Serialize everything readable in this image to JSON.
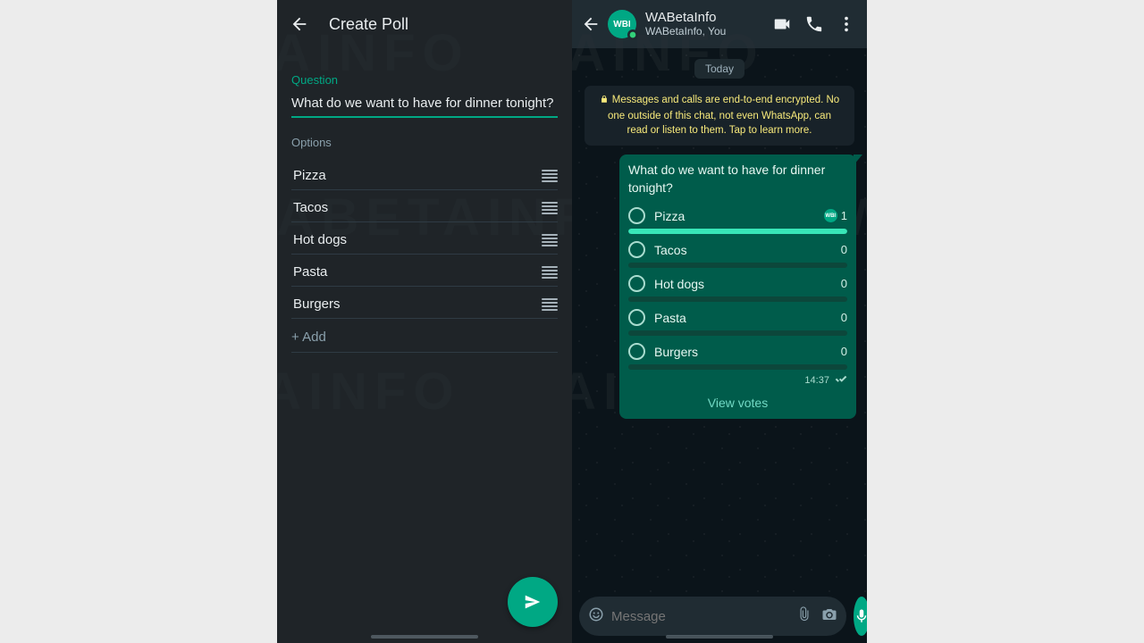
{
  "colors": {
    "accent": "#00a884"
  },
  "watermark": "WABETAINFO",
  "left": {
    "header": {
      "title": "Create Poll"
    },
    "question_label": "Question",
    "question_value": "What do we want to have for dinner tonight?",
    "options_label": "Options",
    "options": [
      {
        "value": "Pizza"
      },
      {
        "value": "Tacos"
      },
      {
        "value": "Hot dogs"
      },
      {
        "value": "Pasta"
      },
      {
        "value": "Burgers"
      }
    ],
    "add_label": "+ Add"
  },
  "right": {
    "header": {
      "title": "WABetaInfo",
      "subtitle": "WABetaInfo, You",
      "avatar_text": "WBI"
    },
    "day_label": "Today",
    "encryption_text": "Messages and calls are end-to-end encrypted. No one outside of this chat, not even WhatsApp, can read or listen to them. Tap to learn more.",
    "poll": {
      "question": "What do we want to have for dinner tonight?",
      "options": [
        {
          "name": "Pizza",
          "count": "1",
          "progress": 100,
          "voted": true
        },
        {
          "name": "Tacos",
          "count": "0",
          "progress": 0,
          "voted": false
        },
        {
          "name": "Hot dogs",
          "count": "0",
          "progress": 0,
          "voted": false
        },
        {
          "name": "Pasta",
          "count": "0",
          "progress": 0,
          "voted": false
        },
        {
          "name": "Burgers",
          "count": "0",
          "progress": 0,
          "voted": false
        }
      ],
      "time": "14:37",
      "view_votes_label": "View votes"
    },
    "input_placeholder": "Message"
  }
}
